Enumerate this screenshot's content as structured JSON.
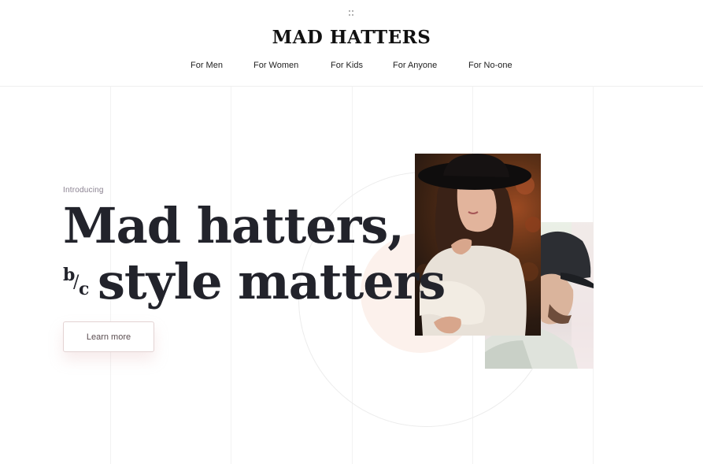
{
  "brand": {
    "logo": "MAD HATTERS"
  },
  "nav": {
    "items": [
      {
        "label": "For Men"
      },
      {
        "label": "For Women"
      },
      {
        "label": "For Kids"
      },
      {
        "label": "For Anyone"
      },
      {
        "label": "For No-one"
      }
    ]
  },
  "hero": {
    "eyebrow": "Introducing",
    "headline_line1": "Mad hatters,",
    "bc_b": "b",
    "bc_slash": "/",
    "bc_c": "c",
    "headline_line2": "style matters",
    "cta_label": "Learn more"
  },
  "icons": {
    "menu": "grid-dots-icon"
  },
  "colors": {
    "text_dark": "#22232b",
    "accent_blush": "#fcf1ec",
    "cta_border": "#e3d3d3"
  }
}
